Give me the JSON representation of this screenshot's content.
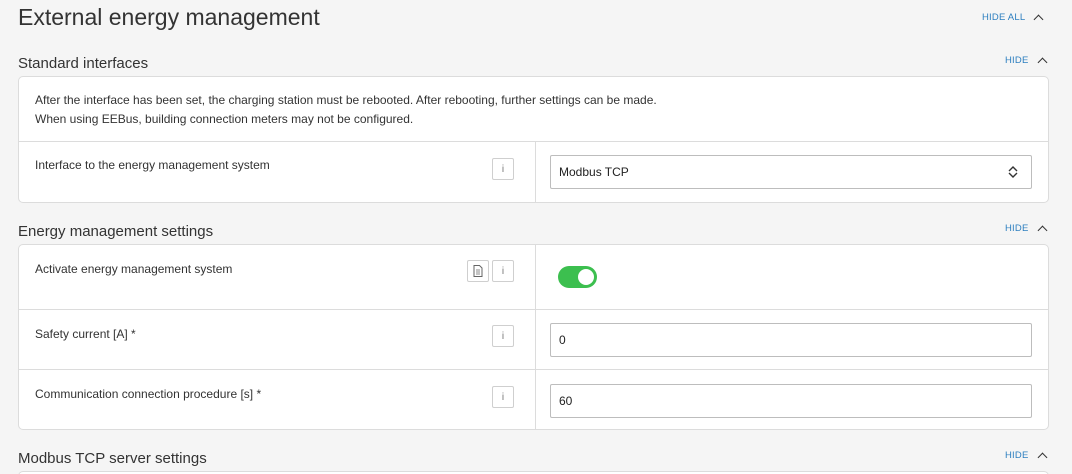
{
  "page": {
    "title": "External energy management",
    "hide_all_label": "HIDE ALL"
  },
  "sections": {
    "standard_interfaces": {
      "title": "Standard interfaces",
      "hide_label": "HIDE",
      "info_line_1": "After the interface has been set, the charging station must be rebooted. After rebooting, further settings can be made.",
      "info_line_2": "When using EEBus, building connection meters may not be configured.",
      "interface_label": "Interface to the energy management system",
      "interface_value": "Modbus TCP",
      "info_button": "i"
    },
    "energy_management": {
      "title": "Energy management settings",
      "hide_label": "HIDE",
      "activate_label": "Activate energy management system",
      "activate_enabled": true,
      "safety_label": "Safety current [A] *",
      "safety_value": "0",
      "comm_label": "Communication connection procedure [s] *",
      "comm_value": "60",
      "info_button": "i"
    },
    "modbus_server": {
      "title": "Modbus TCP server settings",
      "hide_label": "HIDE"
    }
  },
  "colors": {
    "accent_link": "#2d7fc0",
    "toggle_on": "#3cbf4f"
  },
  "icons": {
    "hide_chevron": "chevron-up-icon",
    "select_arrows": "up-down-arrows-icon",
    "doc_button": "document-icon",
    "info_button": "info-icon"
  }
}
